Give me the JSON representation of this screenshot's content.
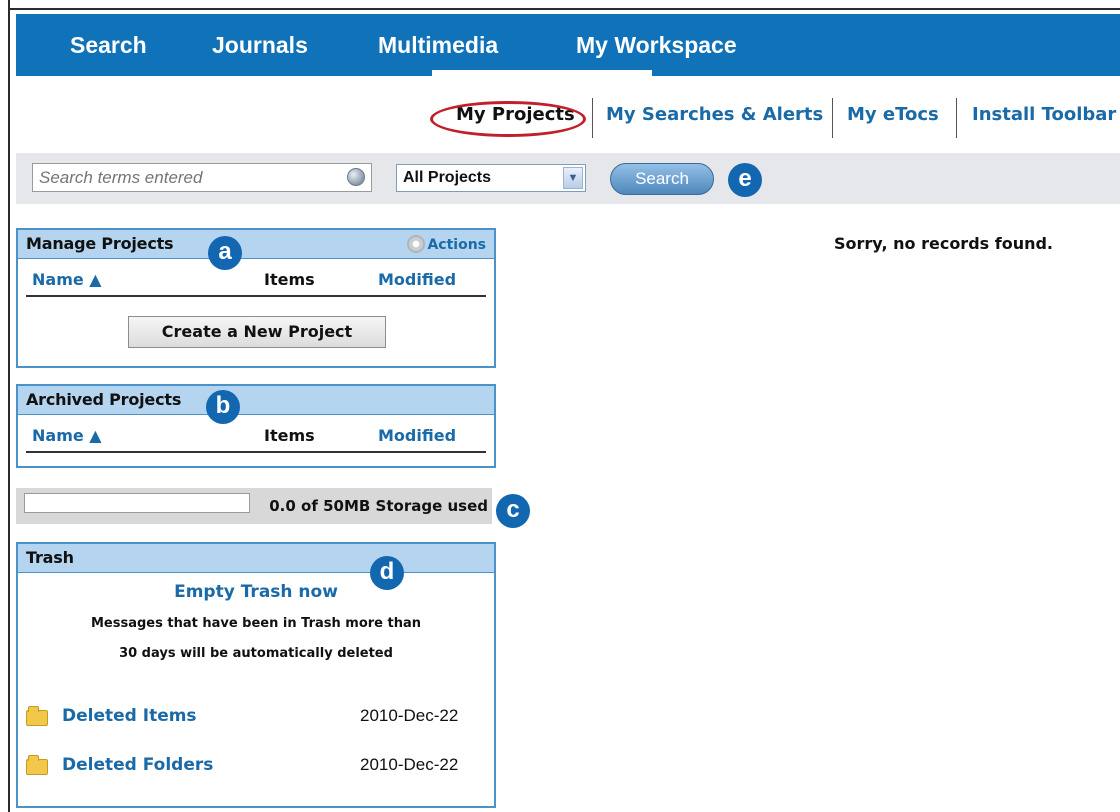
{
  "nav": {
    "items": [
      "Search",
      "Journals",
      "Multimedia",
      "My Workspace"
    ]
  },
  "subnav": {
    "items": [
      "My Projects",
      "My Searches & Alerts",
      "My eTocs",
      "Install Toolbar"
    ],
    "current": "My Projects"
  },
  "search": {
    "placeholder": "Search terms entered",
    "scope_value": "All Projects",
    "button_label": "Search"
  },
  "callouts": [
    "a",
    "b",
    "c",
    "d",
    "e"
  ],
  "manage_projects": {
    "title": "Manage Projects",
    "actions_label": "Actions",
    "columns": {
      "name": "Name ▲",
      "items": "Items",
      "modified": "Modified"
    },
    "create_button": "Create a New Project"
  },
  "archived_projects": {
    "title": "Archived Projects",
    "columns": {
      "name": "Name ▲",
      "items": "Items",
      "modified": "Modified"
    }
  },
  "storage": {
    "label": "0.0 of 50MB Storage used",
    "used_fraction": 0.0
  },
  "trash": {
    "title": "Trash",
    "empty_link": "Empty Trash now",
    "message_line1": "Messages that have been in Trash more than",
    "message_line2": "30 days will be automatically deleted",
    "rows": [
      {
        "name": "Deleted Items",
        "date": "2010-Dec-22"
      },
      {
        "name": "Deleted Folders",
        "date": "2010-Dec-22"
      }
    ]
  },
  "results": {
    "empty_message": "Sorry, no records found."
  },
  "colors": {
    "nav_bg": "#1072b8",
    "panel_header": "#b4d4ef",
    "link": "#1b6aa8",
    "highlight_oval": "#c0202a"
  }
}
